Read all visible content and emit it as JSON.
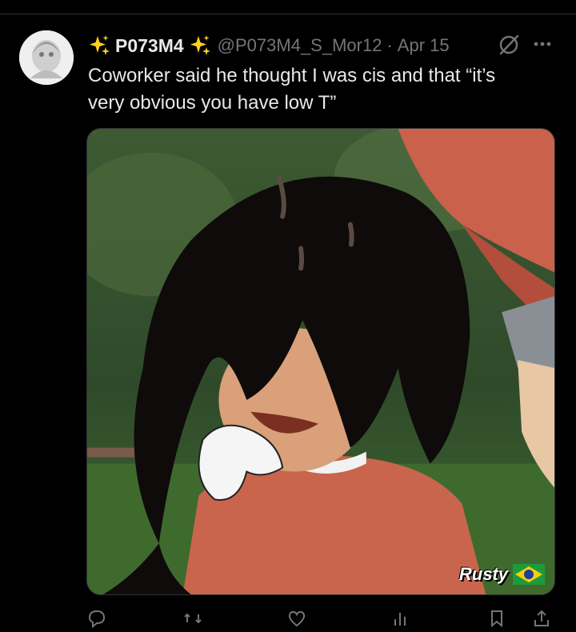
{
  "post": {
    "display_name": "P073M4",
    "handle": "@P073M4_S_Mor12",
    "separator": "·",
    "date": "Apr 15",
    "text": "Coworker said he thought I was cis and that “it’s very obvious you have low T”",
    "icons": {
      "name_decoration": "sparkles-icon",
      "status": "null-icon",
      "menu": "more-icon"
    }
  },
  "media": {
    "signature": "Rusty",
    "flag": "brazil-flag-icon"
  },
  "actions": [
    {
      "name": "reply-icon",
      "count": ""
    },
    {
      "name": "repost-icon",
      "count": ""
    },
    {
      "name": "like-icon",
      "count": ""
    },
    {
      "name": "views-icon",
      "count": ""
    },
    {
      "name": "bookmark-icon",
      "count": ""
    },
    {
      "name": "share-icon",
      "count": ""
    }
  ],
  "colors": {
    "background": "#000000",
    "text": "#e7e9ea",
    "secondary": "#71767b",
    "sparkle": "#ffd21f"
  }
}
